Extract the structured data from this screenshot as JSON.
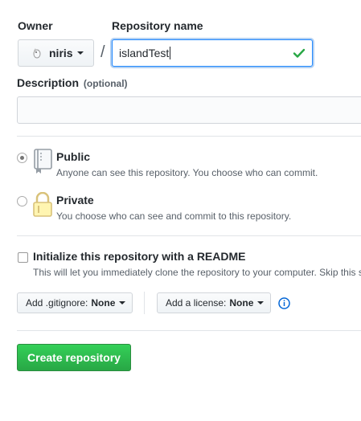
{
  "owner": {
    "label": "Owner",
    "value": "niris"
  },
  "separator": "/",
  "repository": {
    "label": "Repository name",
    "value": "islandTest",
    "valid": true
  },
  "description": {
    "label": "Description",
    "optional": "(optional)",
    "value": ""
  },
  "visibility": {
    "selected": "public",
    "public": {
      "title": "Public",
      "desc": "Anyone can see this repository. You choose who can commit.",
      "icon": "repo-book-icon"
    },
    "private": {
      "title": "Private",
      "desc": "You choose who can see and commit to this repository.",
      "icon": "lock-icon"
    }
  },
  "readme": {
    "checked": false,
    "title": "Initialize this repository with a README",
    "desc": "This will let you immediately clone the repository to your computer. Skip this s"
  },
  "gitignore": {
    "label": "Add .gitignore:",
    "value": "None"
  },
  "license": {
    "label": "Add a license:",
    "value": "None"
  },
  "create_button": "Create repository",
  "colors": {
    "accent_green": "#28a745",
    "focus_blue": "#2188ff",
    "info_blue": "#0366d6",
    "text": "#24292e",
    "muted": "#586069"
  }
}
